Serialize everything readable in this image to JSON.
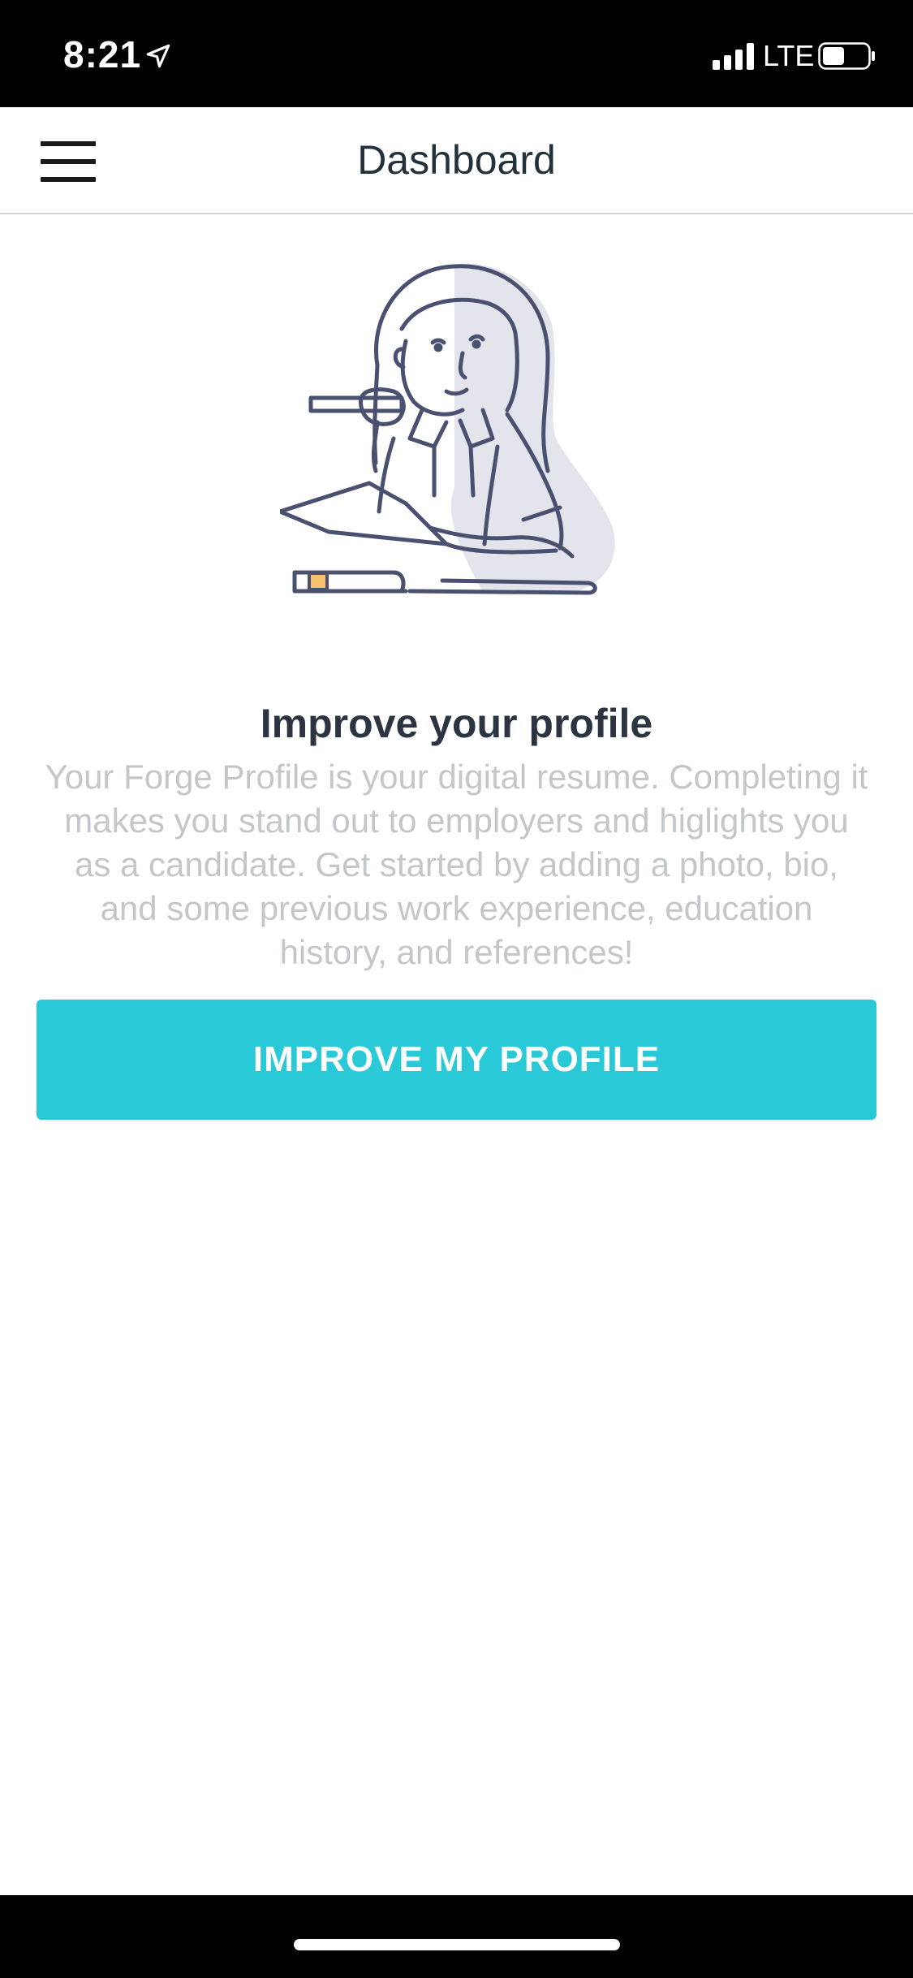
{
  "status_bar": {
    "time": "8:21",
    "network": "LTE",
    "icons": [
      "location-arrow-icon",
      "signal-bars-icon",
      "battery-icon"
    ]
  },
  "header": {
    "title": "Dashboard",
    "menu_icon": "hamburger-menu-icon"
  },
  "profile_prompt": {
    "illustration": "woman-thinking-with-pen-illustration",
    "title": "Improve your profile",
    "body": "Your Forge Profile is your digital resume. Completing it makes you stand out to employers and higlights you as a candidate. Get started by adding a photo, bio, and some previous work experience, education history, and references!",
    "button_label": "IMPROVE MY PROFILE"
  },
  "colors": {
    "accent": "#29c9d8",
    "title_text": "#2c3442",
    "body_text": "#c4c7ca",
    "header_text": "#22313a",
    "illustration_stroke": "#4a5170",
    "illustration_shadow": "#e3e4ec",
    "illustration_highlight": "#f6c26b"
  }
}
